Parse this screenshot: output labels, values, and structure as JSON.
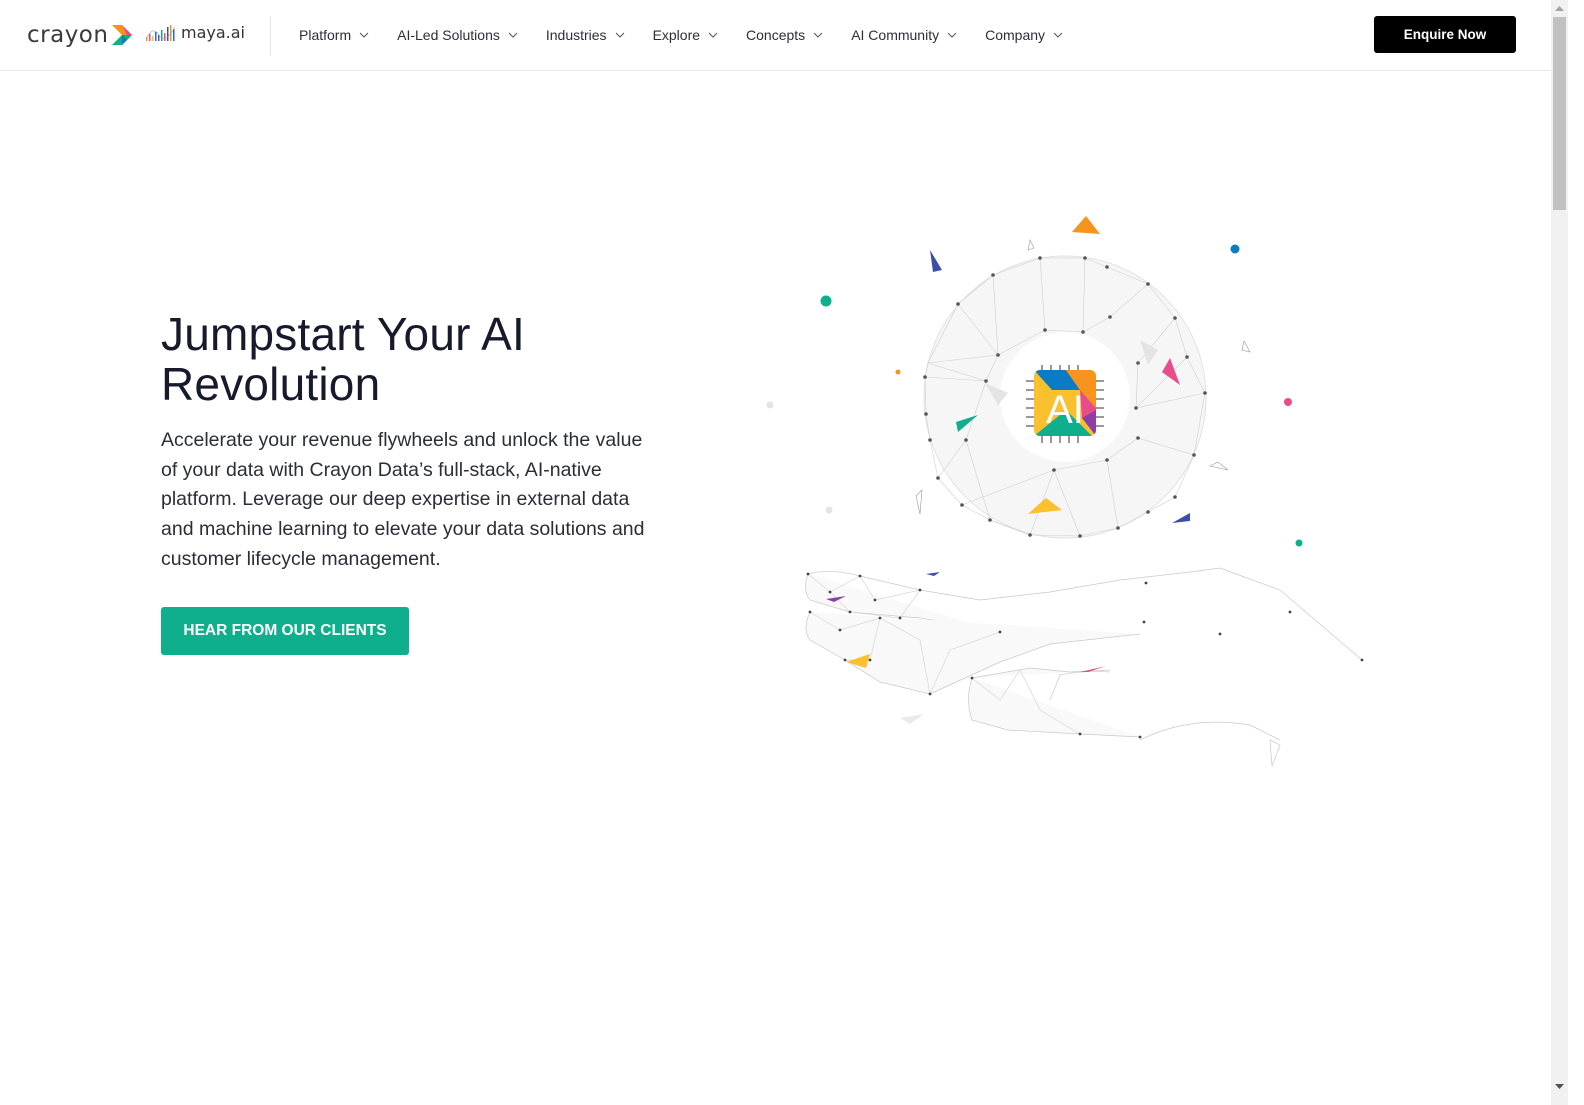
{
  "header": {
    "logo_primary": "crayon",
    "logo_secondary": "maya.ai",
    "nav": [
      {
        "label": "Platform",
        "icon": "chevron-down-icon"
      },
      {
        "label": "AI-Led Solutions",
        "icon": "chevron-down-icon"
      },
      {
        "label": "Industries",
        "icon": "chevron-down-icon"
      },
      {
        "label": "Explore",
        "icon": "chevron-down-icon"
      },
      {
        "label": "Concepts",
        "icon": "chevron-down-icon"
      },
      {
        "label": "AI Community",
        "icon": "chevron-down-icon"
      },
      {
        "label": "Company",
        "icon": "chevron-down-icon"
      }
    ],
    "cta_label": "Enquire Now"
  },
  "hero": {
    "title": "Jumpstart Your AI Revolution",
    "description": "Accelerate your revenue flywheels and unlock the value of your data with Crayon Data’s full-stack, AI-native platform. Leverage our deep expertise in external data and machine learning to elevate your data solutions and customer lifecycle management.",
    "cta_label": "HEAR FROM OUR CLIENTS",
    "illustration": {
      "chip_label": "AI",
      "description": "low-poly hand holding a mesh sphere with an AI chip"
    }
  },
  "colors": {
    "accent_green": "#0fae8c",
    "button_black": "#000000",
    "title_text": "#161a2b",
    "brand_orange": "#f7941d",
    "brand_blue": "#0a7bc4",
    "brand_pink": "#e84c89",
    "brand_yellow": "#fbc02d",
    "brand_purple": "#8e3fa5",
    "brand_indigo": "#3b4fa8"
  }
}
